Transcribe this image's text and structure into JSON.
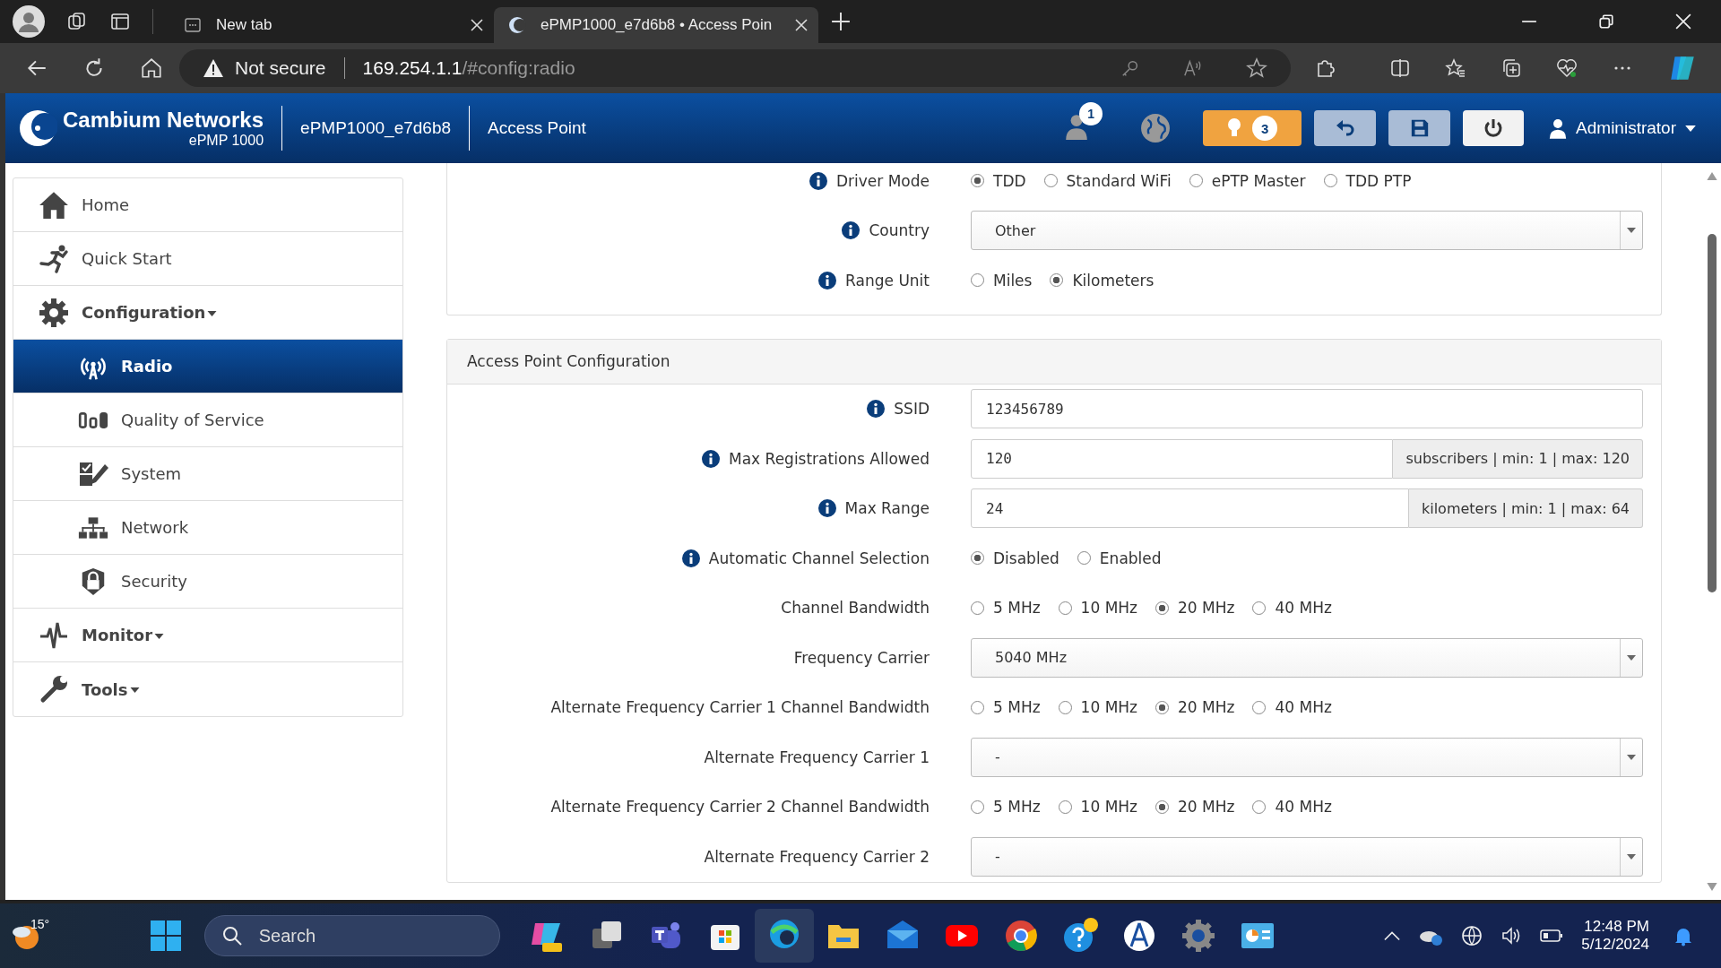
{
  "browser": {
    "tabs": [
      {
        "title": "New tab",
        "selected": false
      },
      {
        "title": "ePMP1000_e7d6b8 • Access Poin",
        "selected": true
      }
    ],
    "address": {
      "warning": "Not secure",
      "host": "169.254.1.1",
      "path": "/#config:radio"
    }
  },
  "header": {
    "brand": "Cambium Networks",
    "model": "ePMP 1000",
    "device": "ePMP1000_e7d6b8",
    "mode": "Access Point",
    "users_badge": "1",
    "alerts_badge": "3",
    "user": "Administrator"
  },
  "sidebar": {
    "items": [
      {
        "label": "Home",
        "selected": false,
        "dropdown": false
      },
      {
        "label": "Quick Start",
        "selected": false,
        "dropdown": false
      },
      {
        "label": "Configuration",
        "selected": false,
        "dropdown": true,
        "children": [
          {
            "label": "Radio",
            "selected": true
          },
          {
            "label": "Quality of Service",
            "selected": false
          },
          {
            "label": "System",
            "selected": false
          },
          {
            "label": "Network",
            "selected": false
          },
          {
            "label": "Security",
            "selected": false
          }
        ]
      },
      {
        "label": "Monitor",
        "selected": false,
        "dropdown": true
      },
      {
        "label": "Tools",
        "selected": false,
        "dropdown": true
      }
    ]
  },
  "radio_panel": {
    "rows": [
      {
        "label": "Driver Mode",
        "info": true,
        "kind": "radio",
        "options": [
          {
            "label": "TDD",
            "selected": true
          },
          {
            "label": "Standard WiFi",
            "selected": false
          },
          {
            "label": "ePTP Master",
            "selected": false
          },
          {
            "label": "TDD PTP",
            "selected": false
          }
        ]
      },
      {
        "label": "Country",
        "info": true,
        "kind": "select",
        "value": "Other"
      },
      {
        "label": "Range Unit",
        "info": true,
        "kind": "radio",
        "options": [
          {
            "label": "Miles",
            "selected": false
          },
          {
            "label": "Kilometers",
            "selected": true
          }
        ]
      }
    ]
  },
  "ap_panel": {
    "title": "Access Point Configuration",
    "rows": [
      {
        "label": "SSID",
        "info": true,
        "kind": "text",
        "value": "123456789"
      },
      {
        "label": "Max Registrations Allowed",
        "info": true,
        "kind": "addon",
        "value": "120",
        "addon": "subscribers | min: 1 | max: 120"
      },
      {
        "label": "Max Range",
        "info": true,
        "kind": "addon",
        "value": "24",
        "addon": "kilometers | min: 1 | max: 64"
      },
      {
        "label": "Automatic Channel Selection",
        "info": true,
        "kind": "radio",
        "options": [
          {
            "label": "Disabled",
            "selected": true
          },
          {
            "label": "Enabled",
            "selected": false
          }
        ]
      },
      {
        "label": "Channel Bandwidth",
        "info": false,
        "kind": "radio",
        "options": [
          {
            "label": "5 MHz",
            "selected": false
          },
          {
            "label": "10 MHz",
            "selected": false
          },
          {
            "label": "20 MHz",
            "selected": true
          },
          {
            "label": "40 MHz",
            "selected": false
          }
        ]
      },
      {
        "label": "Frequency Carrier",
        "info": false,
        "kind": "select",
        "value": "5040 MHz"
      },
      {
        "label": "Alternate Frequency Carrier 1 Channel Bandwidth",
        "info": false,
        "kind": "radio",
        "options": [
          {
            "label": "5 MHz",
            "selected": false
          },
          {
            "label": "10 MHz",
            "selected": false
          },
          {
            "label": "20 MHz",
            "selected": true
          },
          {
            "label": "40 MHz",
            "selected": false
          }
        ]
      },
      {
        "label": "Alternate Frequency Carrier 1",
        "info": false,
        "kind": "select",
        "value": "-"
      },
      {
        "label": "Alternate Frequency Carrier 2 Channel Bandwidth",
        "info": false,
        "kind": "radio",
        "options": [
          {
            "label": "5 MHz",
            "selected": false
          },
          {
            "label": "10 MHz",
            "selected": false
          },
          {
            "label": "20 MHz",
            "selected": true
          },
          {
            "label": "40 MHz",
            "selected": false
          }
        ]
      },
      {
        "label": "Alternate Frequency Carrier 2",
        "info": false,
        "kind": "select",
        "value": "-"
      }
    ]
  },
  "taskbar": {
    "weather": "15°",
    "search_placeholder": "Search",
    "time": "12:48 PM",
    "date": "5/12/2024"
  }
}
